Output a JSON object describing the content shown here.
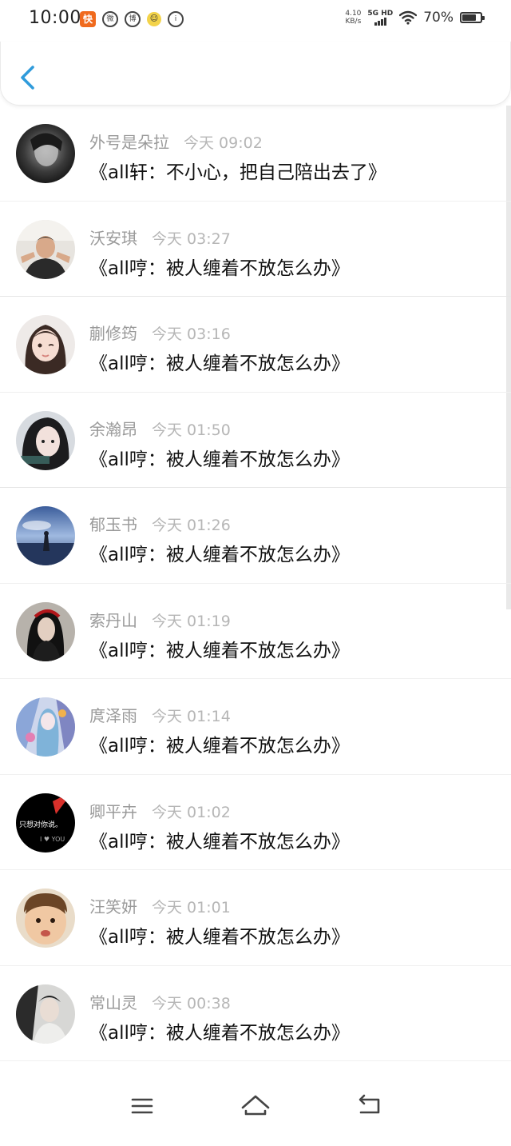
{
  "status_bar": {
    "time": "10:00",
    "net_speed_value": "4.10",
    "net_speed_unit": "KB/s",
    "net_type": "5G HD",
    "battery_percent": "70%",
    "battery_level": 0.7
  },
  "header": {
    "back_icon": "chevron-left-icon",
    "accent_color": "#2f9bdb"
  },
  "messages": [
    {
      "name": "外号是朵拉",
      "time": "今天 09:02",
      "text": "《all轩：不小心，把自己陪出去了》"
    },
    {
      "name": "沃安琪",
      "time": "今天 03:27",
      "text": "《all哼：被人缠着不放怎么办》"
    },
    {
      "name": "蒯修筠",
      "time": "今天 03:16",
      "text": "《all哼：被人缠着不放怎么办》"
    },
    {
      "name": "余瀚昂",
      "time": "今天 01:50",
      "text": "《all哼：被人缠着不放怎么办》"
    },
    {
      "name": "郁玉书",
      "time": "今天 01:26",
      "text": "《all哼：被人缠着不放怎么办》"
    },
    {
      "name": "索丹山",
      "time": "今天 01:19",
      "text": "《all哼：被人缠着不放怎么办》"
    },
    {
      "name": "庹泽雨",
      "time": "今天 01:14",
      "text": "《all哼：被人缠着不放怎么办》"
    },
    {
      "name": "卿平卉",
      "time": "今天 01:02",
      "text": "《all哼：被人缠着不放怎么办》"
    },
    {
      "name": "汪笑妍",
      "time": "今天 01:01",
      "text": "《all哼：被人缠着不放怎么办》"
    },
    {
      "name": "常山灵",
      "time": "今天 00:38",
      "text": "《all哼：被人缠着不放怎么办》"
    }
  ],
  "avatar_texts": {
    "pen_avatar_line1": "只想对你说。",
    "pen_avatar_line2": "I ♥ YOU"
  },
  "bottom_nav": {
    "menu_icon": "menu-icon",
    "home_icon": "home-icon",
    "back_icon": "back-icon"
  }
}
